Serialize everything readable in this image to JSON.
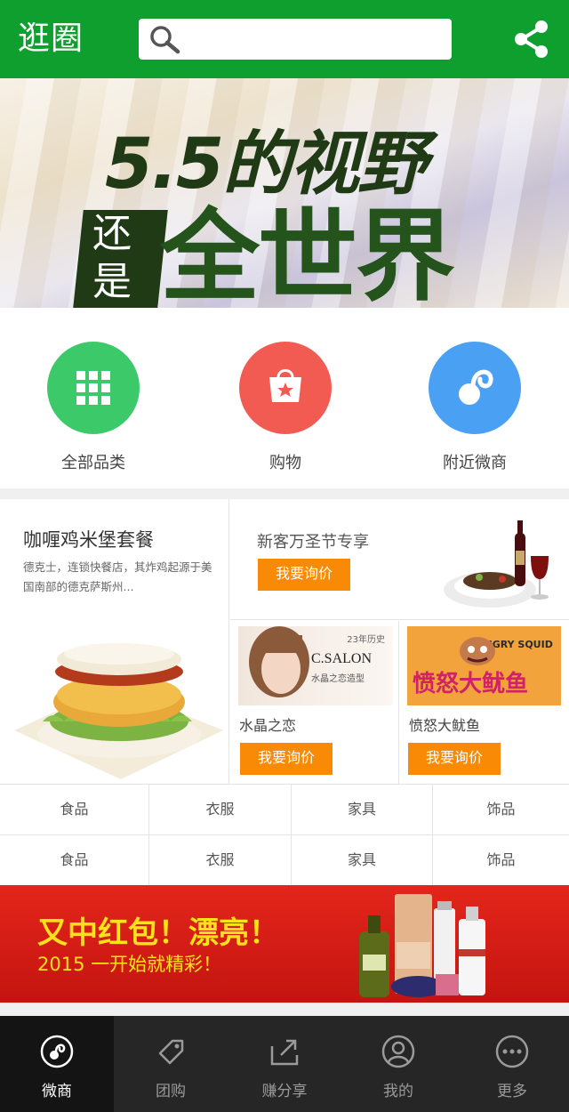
{
  "header": {
    "logo": "逛圈",
    "search_placeholder": "",
    "icons": [
      "search-icon",
      "share-icon"
    ],
    "color": "#0e9f2f"
  },
  "banner": {
    "line1": "5.5的视野",
    "line2": "还是",
    "line3": "全世界"
  },
  "categories": [
    {
      "label": "全部品类",
      "icon": "grid-icon",
      "color": "#3cc96a"
    },
    {
      "label": "购物",
      "icon": "shopping-bag-icon",
      "color": "#f25b51"
    },
    {
      "label": "附近微商",
      "icon": "weishang-icon",
      "color": "#4aa0f2"
    }
  ],
  "promo": {
    "left": {
      "title": "咖喱鸡米堡套餐",
      "desc": "德克士，连锁快餐店，其炸鸡起源于美国南部的德克萨斯州..."
    },
    "top_right": {
      "title": "新客万圣节专享",
      "button": "我要询价"
    },
    "bottom": [
      {
        "name": "水晶之恋",
        "button": "我要询价",
        "image_text": "C.SALON",
        "image_subtext": "水晶之恋造型",
        "badge": "23年历史"
      },
      {
        "name": "愤怒大鱿鱼",
        "button": "我要询价",
        "image_text": "愤怒大鱿鱼",
        "image_subtext": "ANGRY SQUID"
      }
    ],
    "button_color": "#f98a05"
  },
  "grid": [
    [
      "食品",
      "衣服",
      "家具",
      "饰品"
    ],
    [
      "食品",
      "衣服",
      "家具",
      "饰品"
    ]
  ],
  "red_banner": {
    "line1": "又中红包！漂亮！",
    "line2": "2015 一开始就精彩！"
  },
  "nav": [
    {
      "label": "微商",
      "icon": "weishang-icon",
      "active": true
    },
    {
      "label": "团购",
      "icon": "tag-icon",
      "active": false
    },
    {
      "label": "赚分享",
      "icon": "share-out-icon",
      "active": false
    },
    {
      "label": "我的",
      "icon": "user-icon",
      "active": false
    },
    {
      "label": "更多",
      "icon": "more-icon",
      "active": false
    }
  ]
}
